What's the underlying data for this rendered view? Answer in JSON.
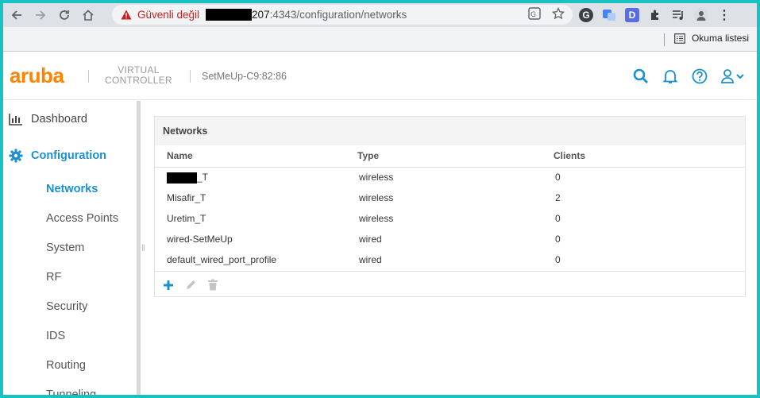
{
  "browser": {
    "security_label": "Güvenli değil",
    "url_host_suffix": "207",
    "url_port": ":4343",
    "url_path": "/configuration/networks",
    "reading_list_label": "Okuma listesi",
    "ext_d_label": "D"
  },
  "app": {
    "logo": "aruba",
    "product_line1": "VIRTUAL",
    "product_line2": "CONTROLLER",
    "device_name": "SetMeUp-C9:82:86"
  },
  "sidebar": {
    "dashboard": "Dashboard",
    "configuration": "Configuration",
    "subitems": [
      "Networks",
      "Access Points",
      "System",
      "RF",
      "Security",
      "IDS",
      "Routing",
      "Tunneling"
    ]
  },
  "networks": {
    "title": "Networks",
    "columns": [
      "Name",
      "Type",
      "Clients"
    ],
    "rows": [
      {
        "name": "_T",
        "type": "wireless",
        "clients": "0"
      },
      {
        "name": "Misafir_T",
        "type": "wireless",
        "clients": "2"
      },
      {
        "name": "Uretim_T",
        "type": "wireless",
        "clients": "0"
      },
      {
        "name": "wired-SetMeUp",
        "type": "wired",
        "clients": "0"
      },
      {
        "name": "default_wired_port_profile",
        "type": "wired",
        "clients": "0"
      }
    ]
  },
  "colors": {
    "accent": "#1a8fd1",
    "brand": "#ff8300",
    "warning": "#c5221f",
    "frame": "#19c2c2"
  }
}
